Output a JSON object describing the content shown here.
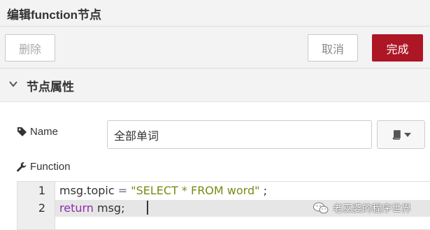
{
  "dialog": {
    "title": "编辑function节点"
  },
  "toolbar": {
    "delete_label": "删除",
    "cancel_label": "取消",
    "done_label": "完成"
  },
  "section": {
    "title": "节点属性"
  },
  "name_field": {
    "label": "Name",
    "value": "全部单词"
  },
  "function_field": {
    "label": "Function",
    "lines": [
      {
        "number": "1",
        "tokens": [
          "msg.topic ",
          "= ",
          "\"SELECT * FROM word\"",
          " ;"
        ]
      },
      {
        "number": "2",
        "tokens": [
          "return",
          " msg;"
        ]
      }
    ],
    "active_line": 2
  },
  "watermark": {
    "text": "老巫婆的程序世界"
  },
  "colors": {
    "accent": "#ad1625",
    "toolbar_bg": "#f3f3f3",
    "string": "#7a8a15",
    "keyword": "#8a2fa7"
  },
  "icons": [
    "chevron-down-icon",
    "tag-icon",
    "book-icon",
    "caret-down-icon",
    "wrench-icon",
    "wechat-icon"
  ]
}
